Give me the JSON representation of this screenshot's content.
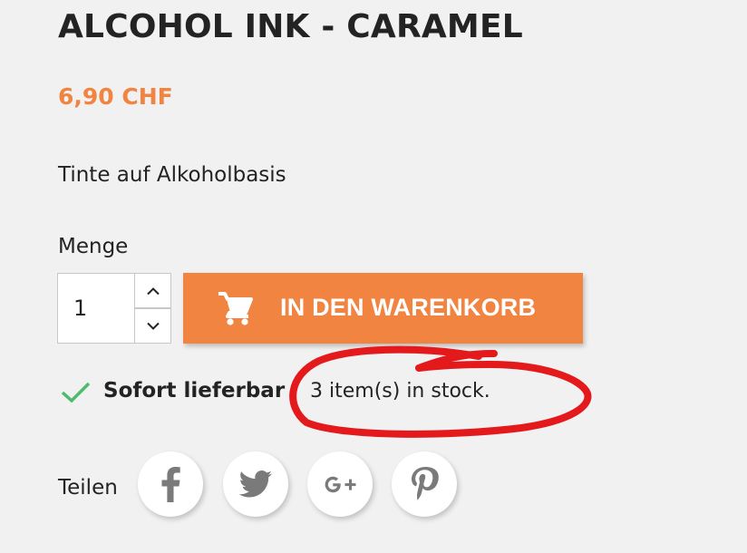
{
  "product": {
    "title": "ALCOHOL INK - CARAMEL",
    "price": "6,90 CHF",
    "short_description": "Tinte auf Alkoholbasis"
  },
  "quantity": {
    "label": "Menge",
    "value": "1"
  },
  "add_to_cart": {
    "label": "IN DEN WARENKORB",
    "icon": "cart-icon"
  },
  "availability": {
    "status": "Sofort lieferbar",
    "stock_text": "3 item(s) in stock.",
    "icon": "check-icon"
  },
  "share": {
    "label": "Teilen",
    "networks": [
      "facebook",
      "twitter",
      "google-plus",
      "pinterest"
    ]
  },
  "colors": {
    "accent": "#f08440",
    "text": "#232323",
    "background": "#f1f1f1",
    "check": "#4cbb6c",
    "social_icon": "#7a7a7a",
    "annotation": "#e3191c"
  }
}
